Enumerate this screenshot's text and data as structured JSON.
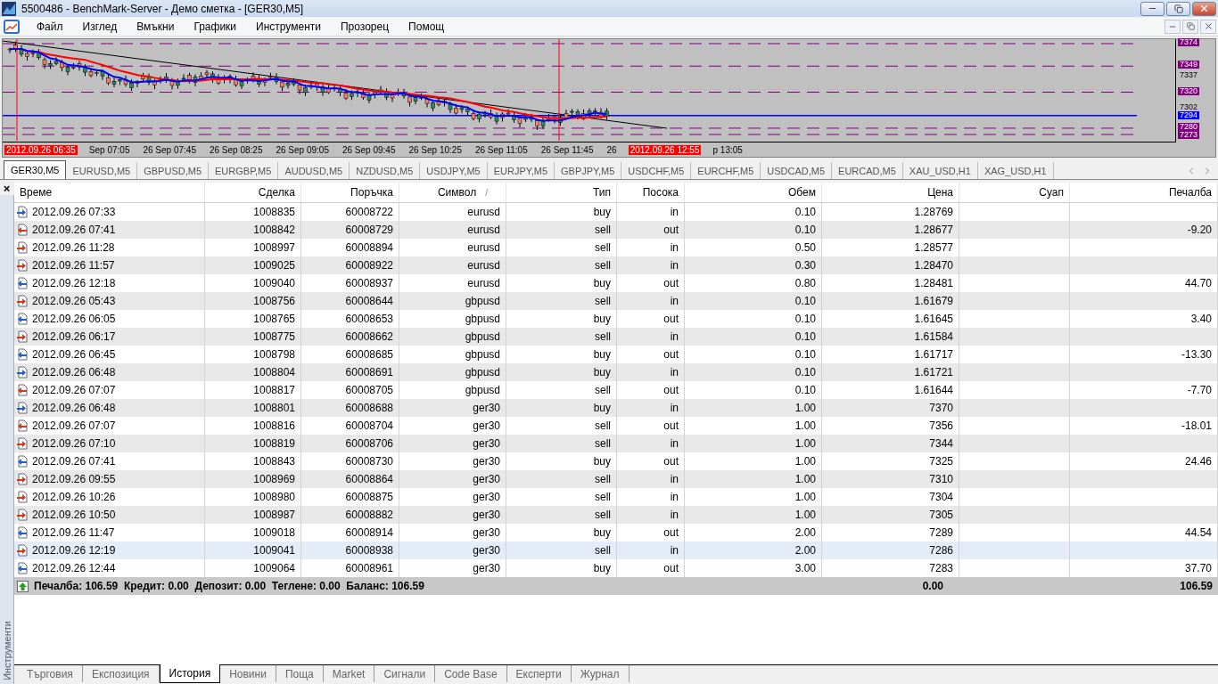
{
  "window": {
    "title": "5500486 - BenchMark-Server - Демо сметка - [GER30,M5]"
  },
  "menu": [
    "Файл",
    "Изглед",
    "Вмъкни",
    "Графики",
    "Инструменти",
    "Прозорец",
    "Помощ"
  ],
  "chart": {
    "price_labels": [
      {
        "text": "7374",
        "kind": "level"
      },
      {
        "text": "7349",
        "kind": "level"
      },
      {
        "text": "7337",
        "kind": "tick"
      },
      {
        "text": "7320",
        "kind": "level"
      },
      {
        "text": "7302",
        "kind": "tick"
      },
      {
        "text": "7294",
        "kind": "current"
      },
      {
        "text": "7280",
        "kind": "level"
      },
      {
        "text": "7273",
        "kind": "level"
      }
    ],
    "time_labels": [
      {
        "text": "2012.09.26 06:35",
        "kind": "marker"
      },
      {
        "text": "Sep 07:05",
        "kind": "time"
      },
      {
        "text": "26 Sep 07:45",
        "kind": "time"
      },
      {
        "text": "26 Sep 08:25",
        "kind": "time"
      },
      {
        "text": "26 Sep 09:05",
        "kind": "time"
      },
      {
        "text": "26 Sep 09:45",
        "kind": "time"
      },
      {
        "text": "26 Sep 10:25",
        "kind": "time"
      },
      {
        "text": "26 Sep 11:05",
        "kind": "time"
      },
      {
        "text": "26 Sep 11:45",
        "kind": "time"
      },
      {
        "text": "26",
        "kind": "time"
      },
      {
        "text": "2012.09.26 12:55",
        "kind": "marker"
      },
      {
        "text": "p 13:05",
        "kind": "time"
      }
    ]
  },
  "chart_tabs": [
    {
      "label": "GER30,M5",
      "selected": true
    },
    {
      "label": "EURUSD,M5",
      "selected": false
    },
    {
      "label": "GBPUSD,M5",
      "selected": false
    },
    {
      "label": "EURGBP,M5",
      "selected": false
    },
    {
      "label": "AUDUSD,M5",
      "selected": false
    },
    {
      "label": "NZDUSD,M5",
      "selected": false
    },
    {
      "label": "USDJPY,M5",
      "selected": false
    },
    {
      "label": "EURJPY,M5",
      "selected": false
    },
    {
      "label": "GBPJPY,M5",
      "selected": false
    },
    {
      "label": "USDCHF,M5",
      "selected": false
    },
    {
      "label": "EURCHF,M5",
      "selected": false
    },
    {
      "label": "USDCAD,M5",
      "selected": false
    },
    {
      "label": "EURCAD,M5",
      "selected": false
    },
    {
      "label": "XAU_USD,H1",
      "selected": false
    },
    {
      "label": "XAG_USD,H1",
      "selected": false
    }
  ],
  "panel": {
    "close": "×",
    "side_label": "Инструменти"
  },
  "table": {
    "columns": [
      "Време",
      "Сделка",
      "Поръчка",
      "Символ",
      "Тип",
      "Посока",
      "Обем",
      "Цена",
      "Суап",
      "Печалба"
    ],
    "sort_mark": "/",
    "rows": [
      {
        "time": "2012.09.26 07:33",
        "deal": "1008835",
        "order": "60008722",
        "symbol": "eurusd",
        "type": "buy",
        "direction": "in",
        "volume": "0.10",
        "price": "1.28769",
        "selected": false
      },
      {
        "time": "2012.09.26 07:41",
        "deal": "1008842",
        "order": "60008729",
        "symbol": "eurusd",
        "type": "sell",
        "direction": "out",
        "volume": "0.10",
        "price": "1.28677",
        "profit": "-9.20",
        "selected": false
      },
      {
        "time": "2012.09.26 11:28",
        "deal": "1008997",
        "order": "60008894",
        "symbol": "eurusd",
        "type": "sell",
        "direction": "in",
        "volume": "0.50",
        "price": "1.28577",
        "selected": false
      },
      {
        "time": "2012.09.26 11:57",
        "deal": "1009025",
        "order": "60008922",
        "symbol": "eurusd",
        "type": "sell",
        "direction": "in",
        "volume": "0.30",
        "price": "1.28470",
        "selected": false
      },
      {
        "time": "2012.09.26 12:18",
        "deal": "1009040",
        "order": "60008937",
        "symbol": "eurusd",
        "type": "buy",
        "direction": "out",
        "volume": "0.80",
        "price": "1.28481",
        "profit": "44.70",
        "selected": false
      },
      {
        "time": "2012.09.26 05:43",
        "deal": "1008756",
        "order": "60008644",
        "symbol": "gbpusd",
        "type": "sell",
        "direction": "in",
        "volume": "0.10",
        "price": "1.61679",
        "selected": false
      },
      {
        "time": "2012.09.26 06:05",
        "deal": "1008765",
        "order": "60008653",
        "symbol": "gbpusd",
        "type": "buy",
        "direction": "out",
        "volume": "0.10",
        "price": "1.61645",
        "profit": "3.40",
        "selected": false
      },
      {
        "time": "2012.09.26 06:17",
        "deal": "1008775",
        "order": "60008662",
        "symbol": "gbpusd",
        "type": "sell",
        "direction": "in",
        "volume": "0.10",
        "price": "1.61584",
        "selected": false
      },
      {
        "time": "2012.09.26 06:45",
        "deal": "1008798",
        "order": "60008685",
        "symbol": "gbpusd",
        "type": "buy",
        "direction": "out",
        "volume": "0.10",
        "price": "1.61717",
        "profit": "-13.30",
        "selected": false
      },
      {
        "time": "2012.09.26 06:48",
        "deal": "1008804",
        "order": "60008691",
        "symbol": "gbpusd",
        "type": "buy",
        "direction": "in",
        "volume": "0.10",
        "price": "1.61721",
        "selected": false
      },
      {
        "time": "2012.09.26 07:07",
        "deal": "1008817",
        "order": "60008705",
        "symbol": "gbpusd",
        "type": "sell",
        "direction": "out",
        "volume": "0.10",
        "price": "1.61644",
        "profit": "-7.70",
        "selected": false
      },
      {
        "time": "2012.09.26 06:48",
        "deal": "1008801",
        "order": "60008688",
        "symbol": "ger30",
        "type": "buy",
        "direction": "in",
        "volume": "1.00",
        "price": "7370",
        "selected": false
      },
      {
        "time": "2012.09.26 07:07",
        "deal": "1008816",
        "order": "60008704",
        "symbol": "ger30",
        "type": "sell",
        "direction": "out",
        "volume": "1.00",
        "price": "7356",
        "profit": "-18.01",
        "selected": false
      },
      {
        "time": "2012.09.26 07:10",
        "deal": "1008819",
        "order": "60008706",
        "symbol": "ger30",
        "type": "sell",
        "direction": "in",
        "volume": "1.00",
        "price": "7344",
        "selected": false
      },
      {
        "time": "2012.09.26 07:41",
        "deal": "1008843",
        "order": "60008730",
        "symbol": "ger30",
        "type": "buy",
        "direction": "out",
        "volume": "1.00",
        "price": "7325",
        "profit": "24.46",
        "selected": false
      },
      {
        "time": "2012.09.26 09:55",
        "deal": "1008969",
        "order": "60008864",
        "symbol": "ger30",
        "type": "sell",
        "direction": "in",
        "volume": "1.00",
        "price": "7310",
        "selected": false
      },
      {
        "time": "2012.09.26 10:26",
        "deal": "1008980",
        "order": "60008875",
        "symbol": "ger30",
        "type": "sell",
        "direction": "in",
        "volume": "1.00",
        "price": "7304",
        "selected": false
      },
      {
        "time": "2012.09.26 10:50",
        "deal": "1008987",
        "order": "60008882",
        "symbol": "ger30",
        "type": "sell",
        "direction": "in",
        "volume": "1.00",
        "price": "7305",
        "selected": false
      },
      {
        "time": "2012.09.26 11:47",
        "deal": "1009018",
        "order": "60008914",
        "symbol": "ger30",
        "type": "buy",
        "direction": "out",
        "volume": "2.00",
        "price": "7289",
        "profit": "44.54",
        "selected": false
      },
      {
        "time": "2012.09.26 12:19",
        "deal": "1009041",
        "order": "60008938",
        "symbol": "ger30",
        "type": "sell",
        "direction": "in",
        "volume": "2.00",
        "price": "7286",
        "selected": true
      },
      {
        "time": "2012.09.26 12:44",
        "deal": "1009064",
        "order": "60008961",
        "symbol": "ger30",
        "type": "buy",
        "direction": "out",
        "volume": "3.00",
        "price": "7283",
        "profit": "37.70",
        "selected": false
      }
    ],
    "summary": {
      "text": "Печалба: 106.59  Кредит: 0.00  Депозит: 0.00  Теглене: 0.00  Баланс: 106.59",
      "swap": "0.00",
      "profit": "106.59"
    }
  },
  "bottom_tabs": [
    {
      "label": "Търговия",
      "selected": false
    },
    {
      "label": "Експозиция",
      "selected": false
    },
    {
      "label": "История",
      "selected": true
    },
    {
      "label": "Новини",
      "selected": false
    },
    {
      "label": "Поща",
      "selected": false
    },
    {
      "label": "Market",
      "selected": false
    },
    {
      "label": "Сигнали",
      "selected": false
    },
    {
      "label": "Code Base",
      "selected": false
    },
    {
      "label": "Експерти",
      "selected": false
    },
    {
      "label": "Журнал",
      "selected": false
    }
  ]
}
